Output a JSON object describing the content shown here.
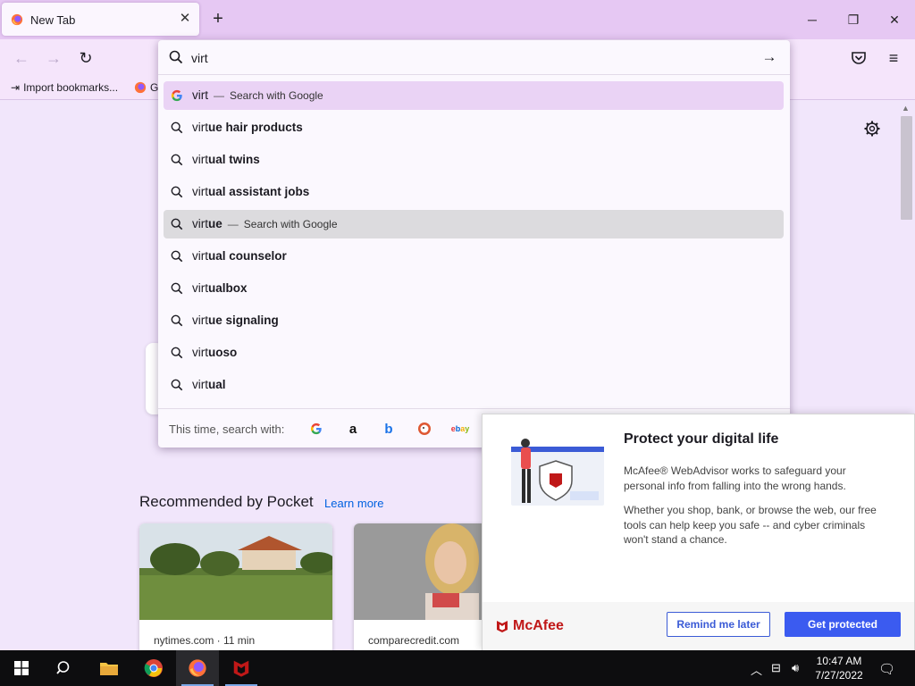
{
  "tab": {
    "title": "New Tab"
  },
  "bookmarks": {
    "import_label": "Import bookmarks...",
    "item2_label": "G"
  },
  "urlbar": {
    "value": "virt",
    "suggestions": [
      {
        "typed": "virt",
        "completion": "",
        "engine_label": "Search with Google"
      },
      {
        "typed": "virt",
        "completion": "ue hair products"
      },
      {
        "typed": "virt",
        "completion": "ual twins"
      },
      {
        "typed": "virt",
        "completion": "ual assistant jobs"
      },
      {
        "typed": "virt",
        "completion": "ue",
        "engine_label": "Search with Google"
      },
      {
        "typed": "virt",
        "completion": "ual counselor"
      },
      {
        "typed": "virt",
        "completion": "ualbox"
      },
      {
        "typed": "virt",
        "completion": "ue signaling"
      },
      {
        "typed": "virt",
        "completion": "uoso"
      },
      {
        "typed": "virt",
        "completion": "ual"
      }
    ],
    "separator": "—",
    "oneoff_label": "This time, search with:",
    "engines": [
      "google-icon",
      "amazon-icon",
      "bing-icon",
      "duckduckgo-icon",
      "ebay-icon"
    ]
  },
  "pocket": {
    "title": "Recommended by Pocket",
    "learn_more": "Learn more",
    "cards": [
      {
        "source": "nytimes.com · 11 min"
      },
      {
        "source": "comparecredit.com"
      }
    ]
  },
  "mcafee": {
    "title": "Protect your digital life",
    "para1": "McAfee® WebAdvisor works to safeguard your personal info from falling into the wrong hands.",
    "para2": "Whether you shop, bank, or browse the web, our free tools can help keep you safe -- and cyber criminals won't stand a chance.",
    "logo_text": "McAfee",
    "remind_label": "Remind me later",
    "protect_label": "Get protected"
  },
  "taskbar": {
    "time": "10:47 AM",
    "date": "7/27/2022"
  },
  "colors": {
    "accent_purple": "#e6c8f3",
    "mcafee_red": "#c01818",
    "button_blue": "#3b5bf0"
  }
}
